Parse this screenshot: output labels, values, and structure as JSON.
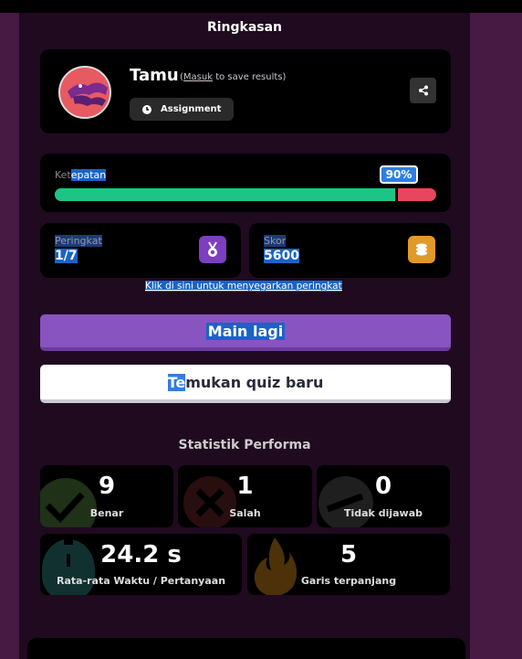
{
  "summary": {
    "heading": "Ringkasan",
    "player": {
      "name": "Tamu",
      "login_open": "(",
      "login_link": "Masuk",
      "login_rest": " to save results)",
      "assignment_label": "Assignment"
    }
  },
  "speed": {
    "label_dim": "Ket",
    "label_sel": "epatan",
    "percent_text": "90%",
    "percent_value": 0.9
  },
  "rank": {
    "label": "Peringkat",
    "value": "1/7"
  },
  "score": {
    "label": "Skor",
    "value": "5600"
  },
  "refresh_link": "Klik di sini untuk menyegarkan peringkat",
  "buttons": {
    "play_again": "Main lagi",
    "new_quiz_hl": "Te",
    "new_quiz_rest": "mukan quiz baru"
  },
  "stats": {
    "title": "Statistik Performa",
    "correct": {
      "value": "9",
      "label": "Benar"
    },
    "wrong": {
      "value": "1",
      "label": "Salah"
    },
    "unanswered": {
      "value": "0",
      "label": "Tidak dijawab"
    },
    "avg_time": {
      "value": "24.2 s",
      "label": "Rata-rata Waktu / Pertanyaan"
    },
    "streak": {
      "value": "5",
      "label": "Garis terpanjang"
    }
  },
  "colors": {
    "accent": "#8854c0",
    "correct": "#1cc585",
    "wrong": "#e8465e",
    "gold": "#e19a2a"
  }
}
